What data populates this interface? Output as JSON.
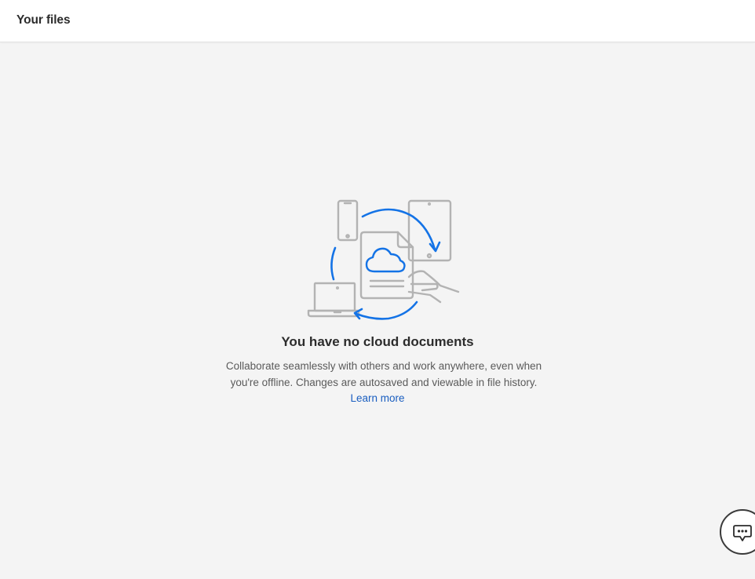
{
  "header": {
    "title": "Your files"
  },
  "empty_state": {
    "illustration_icon": "devices-cloud-sync-illustration",
    "title": "You have no cloud documents",
    "description": "Collaborate seamlessly with others and work anywhere, even when you're offline. Changes are autosaved and viewable in file history.",
    "learn_more_label": "Learn more"
  },
  "chat": {
    "icon": "chat-bubble-icon"
  },
  "colors": {
    "accent": "#1473e6",
    "link": "#1a5ec0",
    "background": "#f4f4f4",
    "illustration_gray": "#b3b3b3"
  }
}
